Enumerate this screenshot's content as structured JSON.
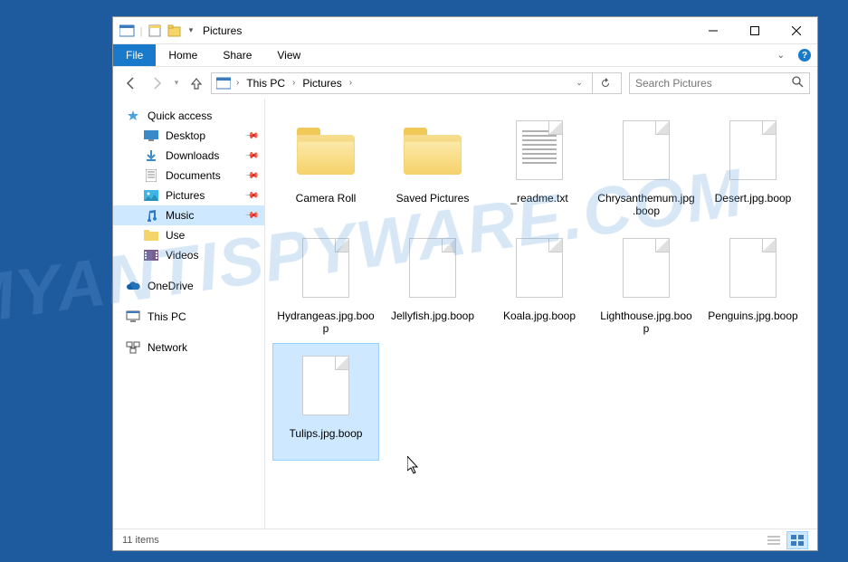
{
  "window": {
    "title": "Pictures"
  },
  "ribbon": {
    "file": "File",
    "tabs": [
      "Home",
      "Share",
      "View"
    ]
  },
  "breadcrumb": {
    "items": [
      "This PC",
      "Pictures"
    ]
  },
  "search": {
    "placeholder": "Search Pictures"
  },
  "sidebar": {
    "quick_access": "Quick access",
    "quick_items": [
      {
        "label": "Desktop",
        "pinned": true,
        "icon": "desktop"
      },
      {
        "label": "Downloads",
        "pinned": true,
        "icon": "downloads"
      },
      {
        "label": "Documents",
        "pinned": true,
        "icon": "documents"
      },
      {
        "label": "Pictures",
        "pinned": true,
        "icon": "pictures"
      },
      {
        "label": "Music",
        "pinned": true,
        "icon": "music",
        "selected": true
      },
      {
        "label": "Use",
        "pinned": false,
        "icon": "folder"
      },
      {
        "label": "Videos",
        "pinned": false,
        "icon": "videos"
      }
    ],
    "onedrive": "OneDrive",
    "thispc": "This PC",
    "network": "Network"
  },
  "items": [
    {
      "name": "Camera Roll",
      "type": "folder"
    },
    {
      "name": "Saved Pictures",
      "type": "folder"
    },
    {
      "name": "_readme.txt",
      "type": "text"
    },
    {
      "name": "Chrysanthemum.jpg.boop",
      "type": "blank"
    },
    {
      "name": "Desert.jpg.boop",
      "type": "blank"
    },
    {
      "name": "Hydrangeas.jpg.boop",
      "type": "blank"
    },
    {
      "name": "Jellyfish.jpg.boop",
      "type": "blank"
    },
    {
      "name": "Koala.jpg.boop",
      "type": "blank"
    },
    {
      "name": "Lighthouse.jpg.boop",
      "type": "blank"
    },
    {
      "name": "Penguins.jpg.boop",
      "type": "blank"
    },
    {
      "name": "Tulips.jpg.boop",
      "type": "blank",
      "selected": true
    }
  ],
  "statusbar": {
    "count": "11 items"
  },
  "watermark": "MYANTISPYWARE.COM"
}
